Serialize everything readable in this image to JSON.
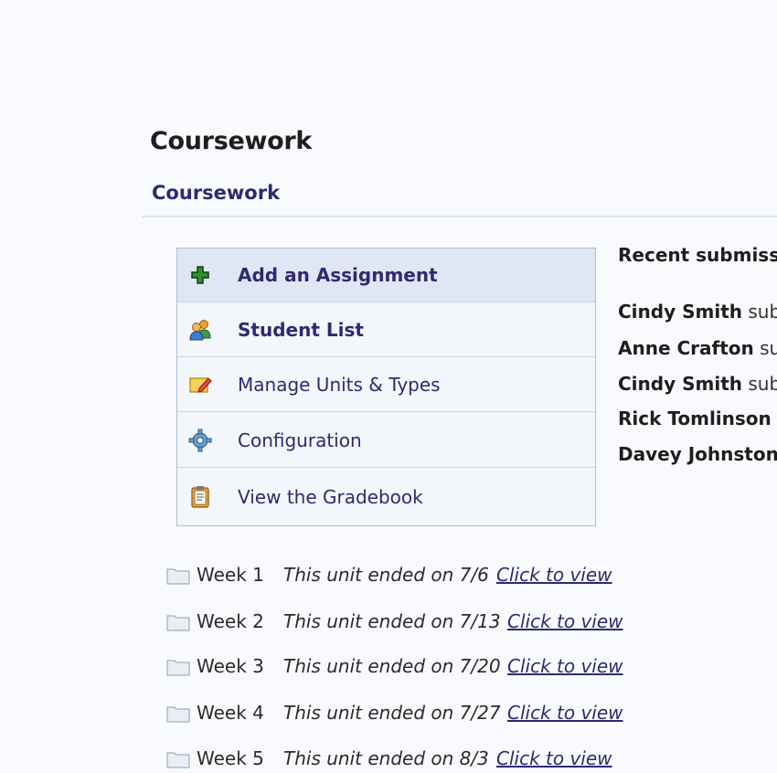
{
  "page": {
    "title": "Coursework"
  },
  "section": {
    "title": "Coursework"
  },
  "menu": {
    "items": [
      {
        "label": "Add an Assignment",
        "icon": "plus-icon"
      },
      {
        "label": "Student List",
        "icon": "users-icon"
      },
      {
        "label": "Manage Units & Types",
        "icon": "edit-icon"
      },
      {
        "label": "Configuration",
        "icon": "gear-icon"
      },
      {
        "label": "View the Gradebook",
        "icon": "clipboard-icon"
      }
    ]
  },
  "recent": {
    "heading": "Recent submissi",
    "items": [
      {
        "name": "Cindy Smith",
        "action": "subr"
      },
      {
        "name": "Anne Crafton",
        "action": "sub"
      },
      {
        "name": "Cindy Smith",
        "action": "subr"
      },
      {
        "name": "Rick Tomlinson",
        "action": "s"
      },
      {
        "name": "Davey Johnston",
        "action": ""
      }
    ]
  },
  "units": [
    {
      "name": "Week 1",
      "status": "This unit ended on 7/6",
      "link": "Click to view"
    },
    {
      "name": "Week 2",
      "status": "This unit ended on 7/13",
      "link": "Click to view"
    },
    {
      "name": "Week 3",
      "status": "This unit ended on 7/20",
      "link": "Click to view"
    },
    {
      "name": "Week 4",
      "status": "This unit ended on 7/27",
      "link": "Click to view"
    },
    {
      "name": "Week 5",
      "status": "This unit ended on 8/3",
      "link": "Click to view"
    }
  ],
  "colors": {
    "accent": "#2e2a72",
    "menu_border": "#a8c3d6",
    "menu_highlight": "#e1e6f4"
  }
}
